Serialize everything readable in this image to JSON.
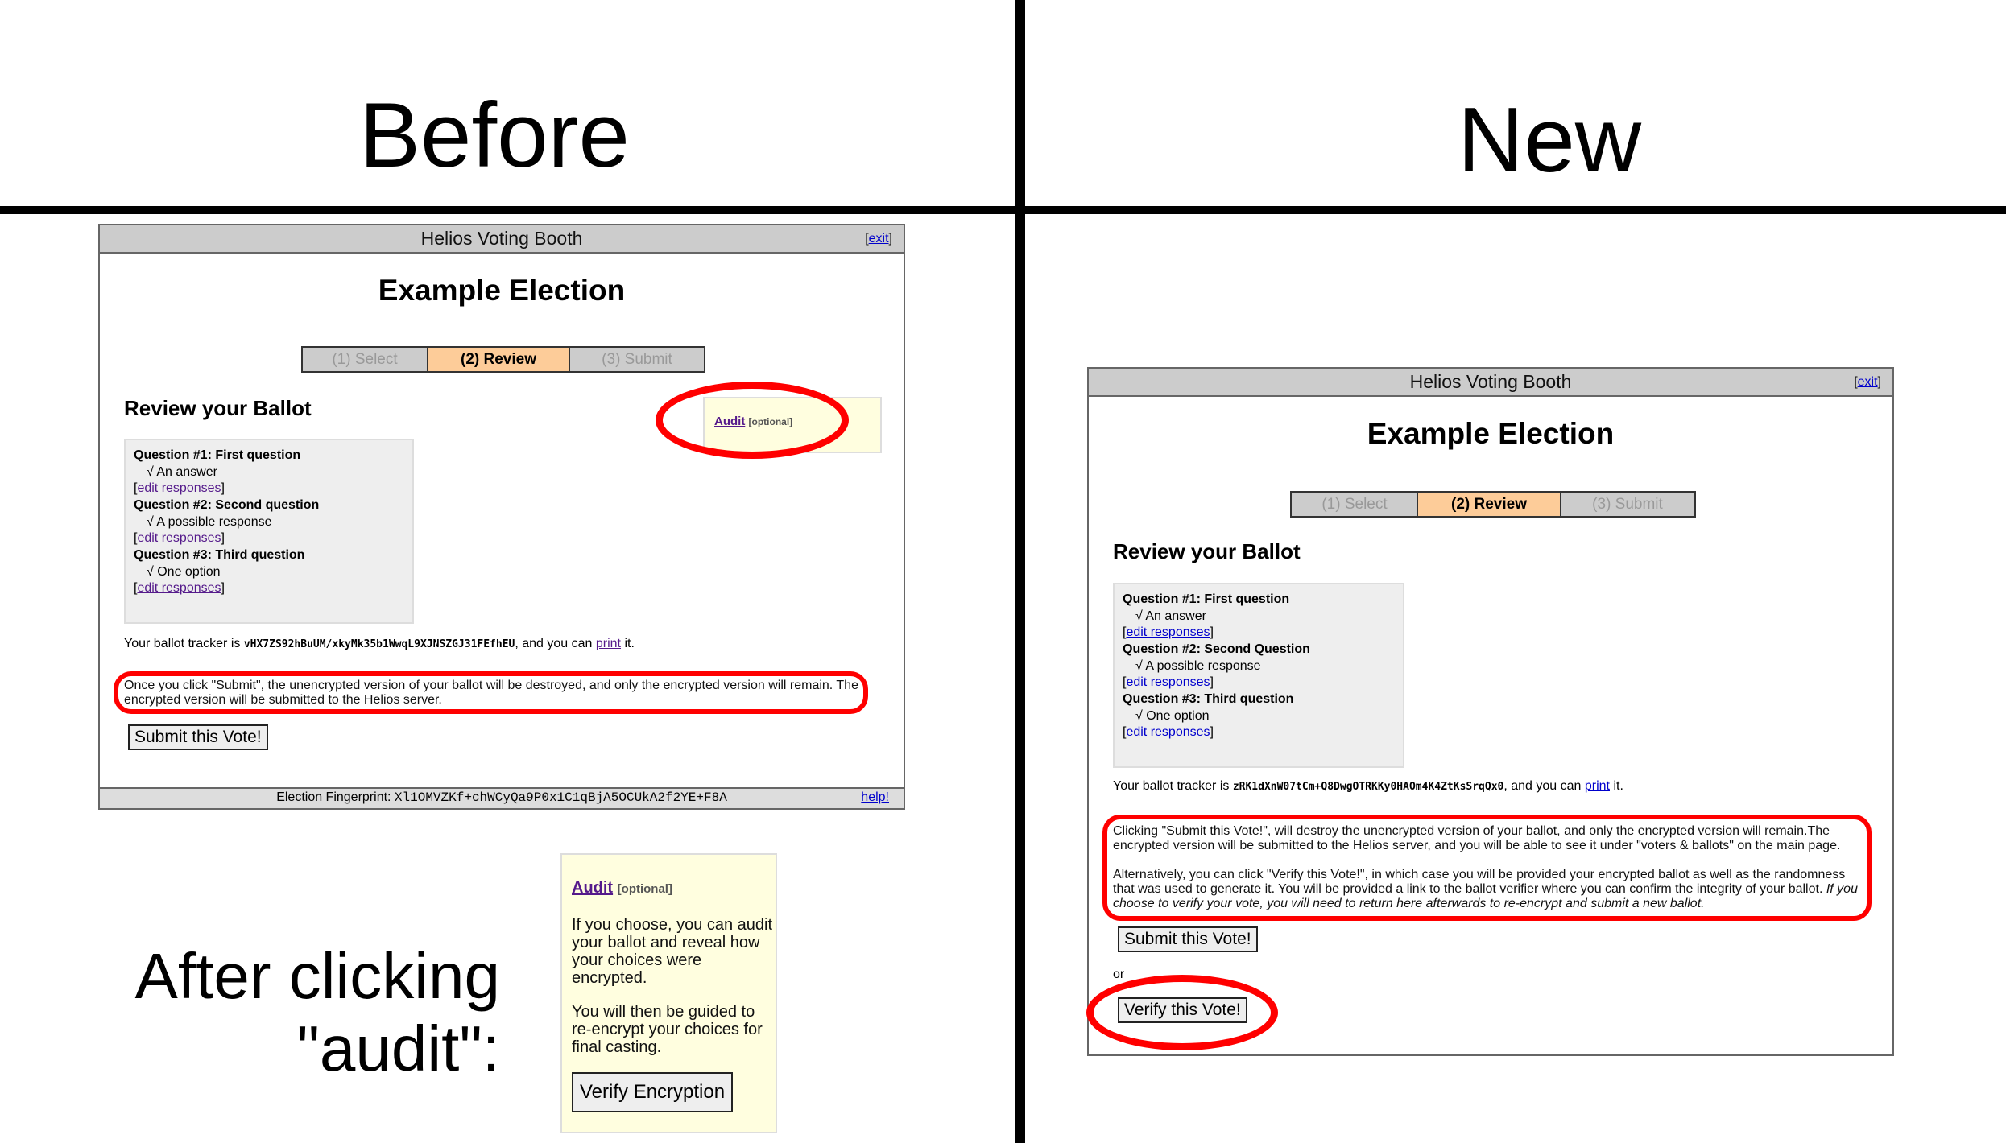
{
  "labels": {
    "before": "Before",
    "new": "New",
    "after_line1": "After clicking",
    "after_line2": "\"audit\":"
  },
  "booth": {
    "header_title": "Helios Voting Booth",
    "exit_open": "[",
    "exit_label": "exit",
    "exit_close": "]",
    "election_title": "Example Election",
    "tabs": [
      {
        "label": "(1) Select",
        "state": "inactive"
      },
      {
        "label": "(2) Review",
        "state": "active"
      },
      {
        "label": "(3) Submit",
        "state": "inactive"
      }
    ],
    "review_heading": "Review your Ballot",
    "edit_open": "[",
    "edit_label": "edit responses",
    "edit_close": "]",
    "tracker_prefix": "Your ballot tracker is ",
    "tracker_mid": ", and you can ",
    "print_label": "print",
    "tracker_suffix": " it.",
    "submit_button": "Submit this Vote!"
  },
  "before": {
    "questions": [
      {
        "title": "Question #1: First question",
        "answer": "√ An answer"
      },
      {
        "title": "Question #2: Second question",
        "answer": "√ A possible response"
      },
      {
        "title": "Question #3: Third question",
        "answer": "√ One option"
      }
    ],
    "tracker_code": "vHX7ZS92hBuUM/xkyMk35b1WwqL9XJNSZGJ31FEfhEU",
    "audit_link": "Audit",
    "audit_optional": "[optional]",
    "note": "Once you click \"Submit\", the unencrypted version of your ballot will be destroyed, and only the encrypted version will remain. The encrypted version will be submitted to the Helios server.",
    "footer_label": "Election Fingerprint: ",
    "fingerprint": "Xl1OMVZKf+chWCyQa9P0x1C1qBjA5OCUkA2f2YE+F8A",
    "help_label": "help!"
  },
  "after_audit": {
    "audit_link": "Audit",
    "audit_optional": "[optional]",
    "paragraph1": "If you choose, you can audit your ballot and reveal how your choices were encrypted.",
    "paragraph2": "You will then be guided to re-encrypt your choices for final casting.",
    "verify_button": "Verify Encryption"
  },
  "new": {
    "questions": [
      {
        "title": "Question #1: First question",
        "answer": "√ An answer"
      },
      {
        "title": "Question #2: Second Question",
        "answer": "√ A possible response"
      },
      {
        "title": "Question #3: Third question",
        "answer": "√ One option"
      }
    ],
    "tracker_code": "zRK1dXnW07tCm+Q8DwgOTRKKy0HAOm4K4ZtKsSrqQx0",
    "note_p1": "Clicking \"Submit this Vote!\", will destroy the unencrypted version of your ballot, and only the encrypted version will remain.The encrypted version will be submitted to the Helios server, and you will be able to see it under \"voters & ballots\" on the main page.",
    "note_p2": "Alternatively, you can click \"Verify this Vote!\", in which case you will be provided your encrypted ballot as well as the randomness that was used to generate it. You will be provided a link to the ballot verifier where you can confirm the integrity of your ballot. ",
    "note_p2_italic": "If you choose to verify your vote, you will need to return here afterwards to re-encrypt and submit a new ballot.",
    "or_label": "or",
    "verify_button": "Verify this Vote!"
  },
  "colors": {
    "highlight": "#ff0000",
    "active_tab": "#fdcc99",
    "header_bg": "#cccccc",
    "audit_bg": "#fffedf",
    "link": "#0000cc",
    "visited_link": "#551a8b"
  }
}
